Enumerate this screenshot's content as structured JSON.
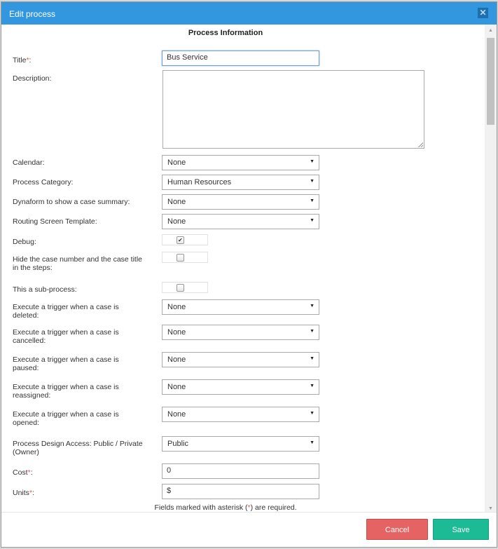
{
  "dialog": {
    "title": "Edit process",
    "close_icon": "close-icon"
  },
  "section_title": "Process Information",
  "fields": {
    "title": {
      "label": "Title",
      "required_mark": "*",
      "suffix": ":",
      "value": "Bus Service"
    },
    "description": {
      "label": "Description:",
      "value": ""
    },
    "calendar": {
      "label": "Calendar:",
      "value": "None"
    },
    "process_category": {
      "label": "Process Category:",
      "value": "Human Resources"
    },
    "dynaform_summary": {
      "label": "Dynaform to show a case summary:",
      "value": "None"
    },
    "routing_template": {
      "label": "Routing Screen Template:",
      "value": "None"
    },
    "debug": {
      "label": "Debug:",
      "checked": true,
      "check_glyph": "✔"
    },
    "hide_case_number": {
      "label": "Hide the case number and the case title in the steps:",
      "checked": false
    },
    "sub_process": {
      "label": "This a sub-process:",
      "checked": false
    },
    "trigger_deleted": {
      "label": "Execute a trigger when a case is deleted:",
      "value": "None"
    },
    "trigger_cancelled": {
      "label": "Execute a trigger when a case is cancelled:",
      "value": "None"
    },
    "trigger_paused": {
      "label": "Execute a trigger when a case is paused:",
      "value": "None"
    },
    "trigger_reassigned": {
      "label": "Execute a trigger when a case is reassigned:",
      "value": "None"
    },
    "trigger_opened": {
      "label": "Execute a trigger when a case is opened:",
      "value": "None"
    },
    "design_access": {
      "label": "Process Design Access: Public / Private (Owner)",
      "value": "Public"
    },
    "cost": {
      "label": "Cost",
      "required_mark": "*",
      "suffix": ":",
      "value": "0"
    },
    "units": {
      "label": "Units",
      "required_mark": "*",
      "suffix": ":",
      "value": "$"
    }
  },
  "note": {
    "before": "Fields marked with asterisk (",
    "mark": "*",
    "after": ") are required."
  },
  "caret_glyph": "▼",
  "scroll": {
    "up_glyph": "▲",
    "down_glyph": "▼"
  },
  "footer": {
    "cancel_label": "Cancel",
    "save_label": "Save"
  },
  "colors": {
    "titlebar": "#3397e0",
    "cancel": "#e66363",
    "save": "#1dbb95",
    "required": "#e35a5a"
  }
}
